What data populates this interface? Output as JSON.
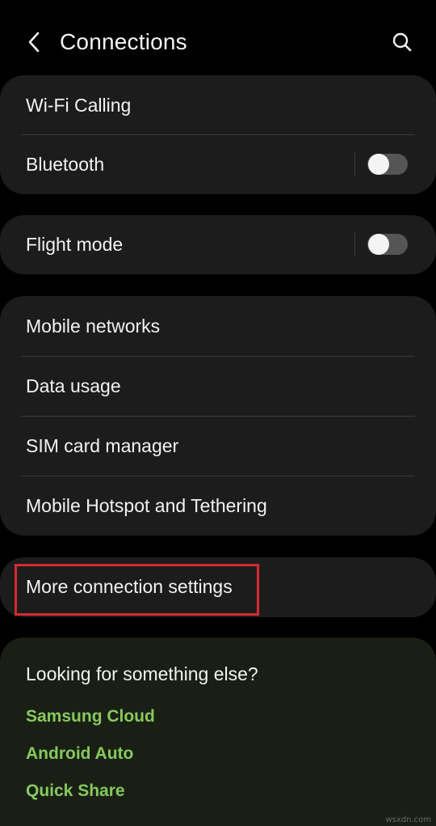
{
  "header": {
    "title": "Connections",
    "back_icon": "chevron-left-icon",
    "search_icon": "search-icon"
  },
  "groups": {
    "group1": {
      "wifi_calling": "Wi-Fi Calling",
      "bluetooth": "Bluetooth",
      "bluetooth_on": false
    },
    "group2": {
      "flight_mode": "Flight mode",
      "flight_mode_on": false
    },
    "group3": {
      "mobile_networks": "Mobile networks",
      "data_usage": "Data usage",
      "sim_card_manager": "SIM card manager",
      "hotspot": "Mobile Hotspot and Tethering"
    },
    "group4": {
      "more_connection_settings": "More connection settings"
    }
  },
  "suggestions": {
    "heading": "Looking for something else?",
    "links": [
      "Samsung Cloud",
      "Android Auto",
      "Quick Share"
    ]
  },
  "watermark": "wsxdn.com",
  "colors": {
    "background": "#000000",
    "card": "#1c1c1c",
    "suggestion_card": "#1a1f16",
    "link_green": "#86c95c",
    "highlight_red": "#d42a33"
  }
}
